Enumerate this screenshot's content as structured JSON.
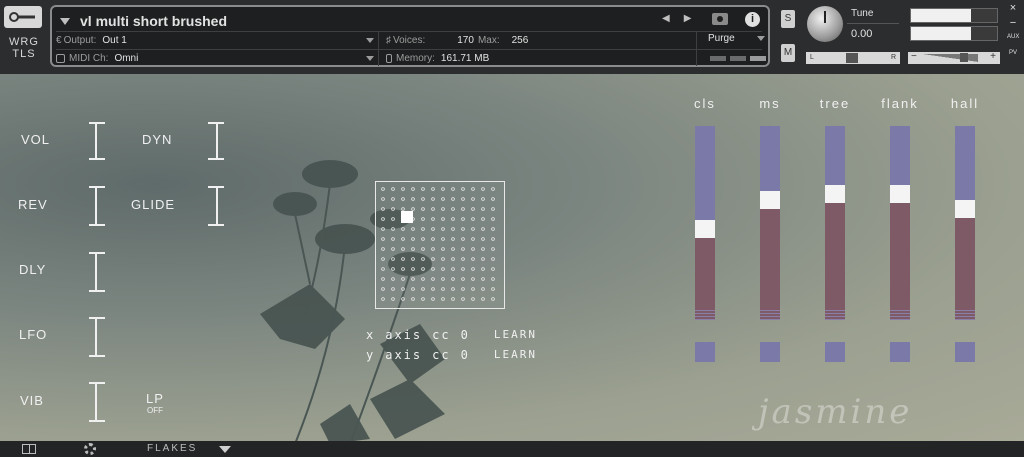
{
  "header": {
    "logo": [
      "WRG",
      "TLS"
    ],
    "instrument_name": "vl multi short brushed",
    "output_label": "Output:",
    "output_value": "Out 1",
    "midi_label": "MIDI Ch:",
    "midi_value": "Omni",
    "voices_label": "Voices:",
    "voices_value": "170",
    "max_label": "Max:",
    "max_value": "256",
    "memory_label": "Memory:",
    "memory_value": "161.71 MB",
    "purge_label": "Purge",
    "solo_label": "S",
    "mute_label": "M",
    "tune_label": "Tune",
    "tune_value": "0.00",
    "pan_left": "L",
    "pan_right": "R",
    "vol_minus": "−",
    "vol_plus": "+",
    "close_label": "×",
    "minimize_label": "−",
    "aux_label": "AUX",
    "pv_label": "PV",
    "meter_levels": [
      0.7,
      0.7
    ]
  },
  "controls": {
    "left": [
      "VOL",
      "REV",
      "DLY",
      "LFO",
      "VIB"
    ],
    "right": [
      "DYN",
      "GLIDE"
    ],
    "lp_label": "LP",
    "lp_state": "OFF"
  },
  "xy_pad": {
    "handle_x": 0.24,
    "handle_y": 0.28,
    "x_axis": {
      "name": "x",
      "word": "axis",
      "cc": "cc",
      "value": "0",
      "learn": "LEARN"
    },
    "y_axis": {
      "name": "y",
      "word": "axis",
      "cc": "cc",
      "value": "0",
      "learn": "LEARN"
    }
  },
  "mics": [
    {
      "label": "cls",
      "level": 0.47
    },
    {
      "label": "ms",
      "level": 0.62
    },
    {
      "label": "tree",
      "level": 0.65
    },
    {
      "label": "flank",
      "level": 0.65
    },
    {
      "label": "hall",
      "level": 0.57
    }
  ],
  "watermark": "jasmine",
  "footer": {
    "preset": "FLAKES"
  }
}
